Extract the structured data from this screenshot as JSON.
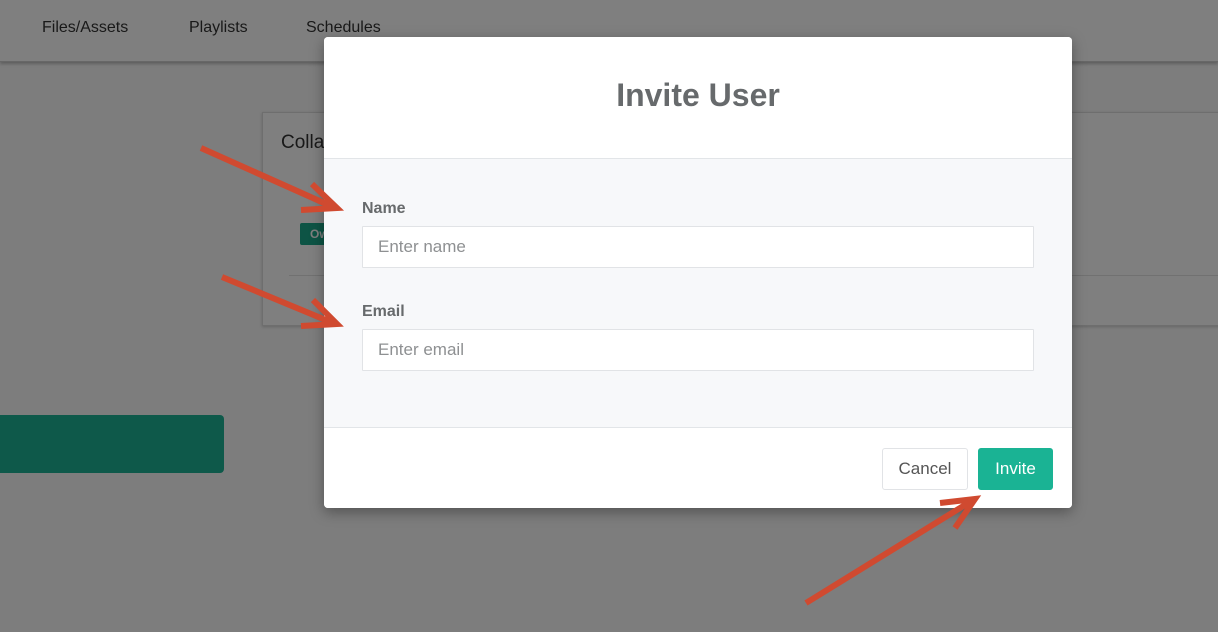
{
  "nav": {
    "items": [
      "Files/Assets",
      "Playlists",
      "Schedules"
    ]
  },
  "background_card": {
    "title": "Colla",
    "badge": "Ow"
  },
  "modal": {
    "title": "Invite User",
    "name_label": "Name",
    "name_placeholder": "Enter name",
    "name_value": "",
    "email_label": "Email",
    "email_placeholder": "Enter email",
    "email_value": "",
    "cancel_label": "Cancel",
    "invite_label": "Invite"
  },
  "colors": {
    "accent": "#1ab394",
    "annotation_arrow": "#d04a30",
    "overlay": "rgba(0,0,0,0.5)"
  }
}
